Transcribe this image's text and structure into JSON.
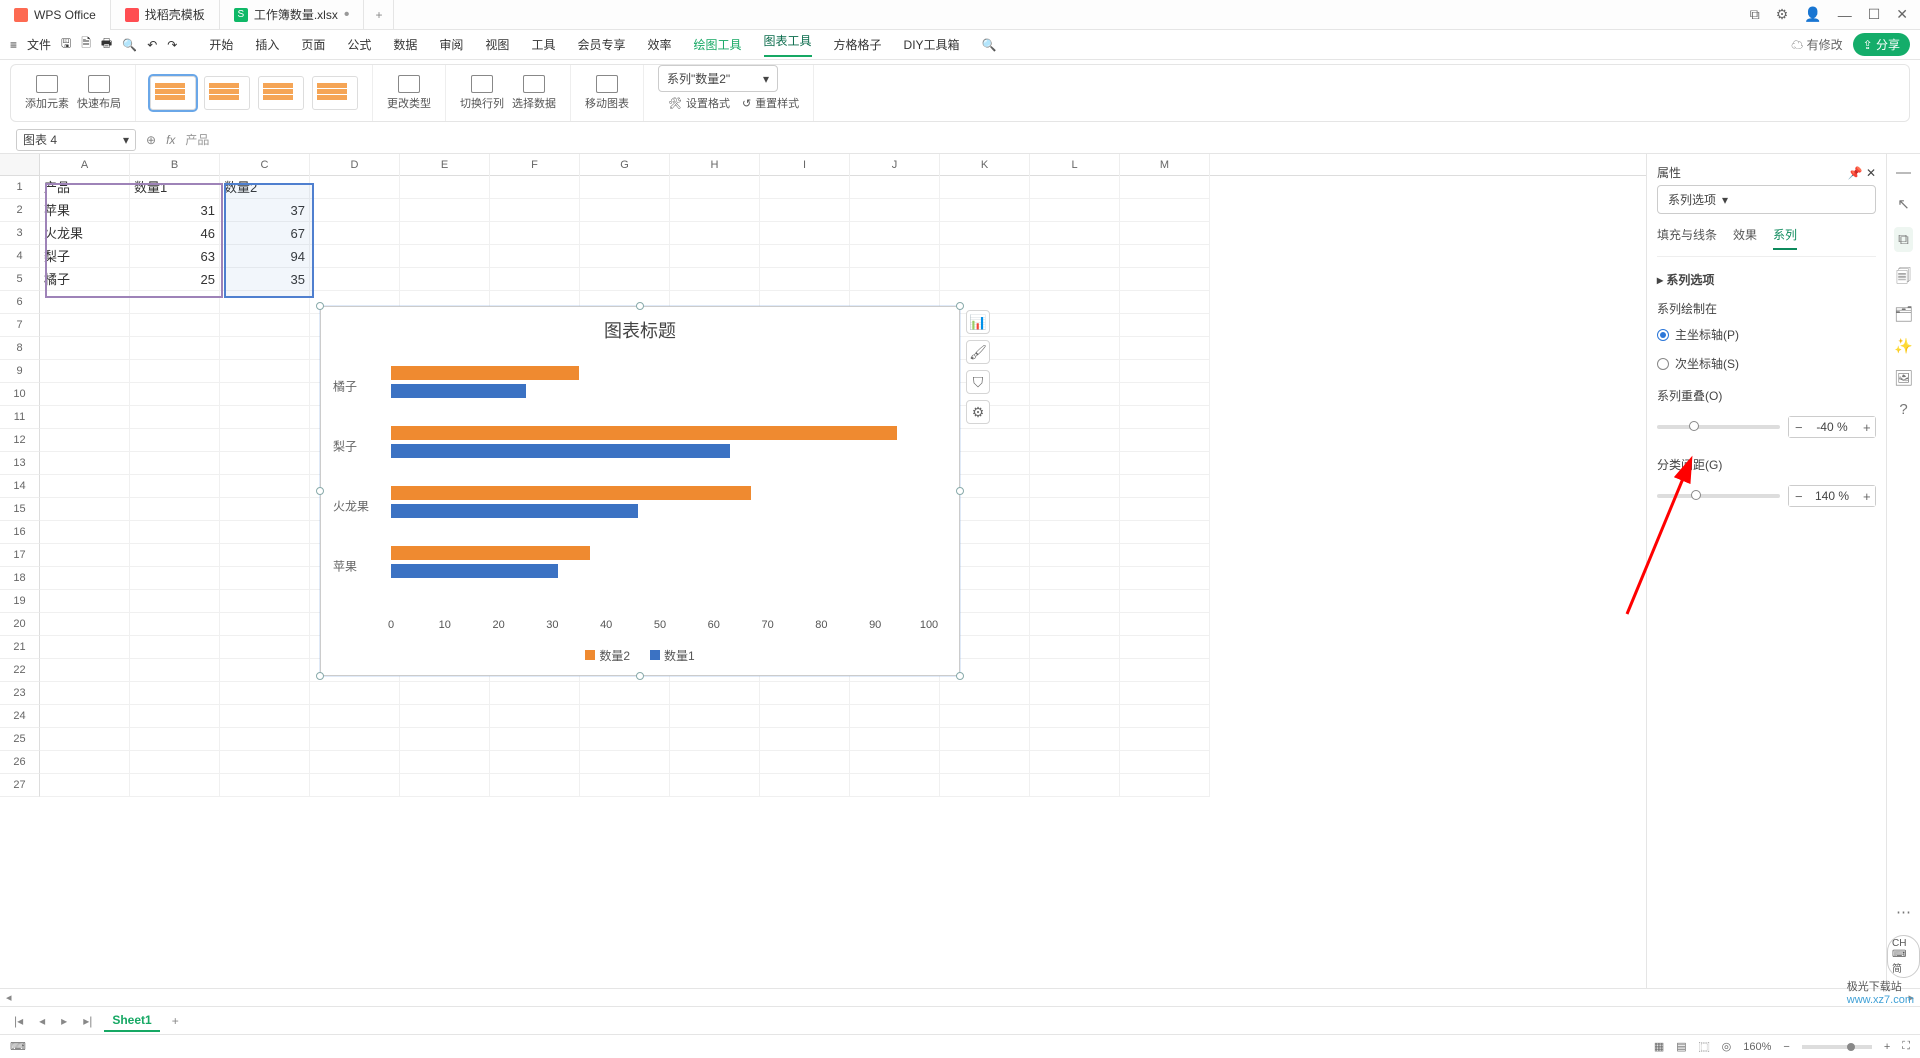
{
  "titlebar": {
    "tabs": [
      {
        "label": "WPS Office"
      },
      {
        "label": "找稻壳模板"
      },
      {
        "label": "工作簿数量.xlsx"
      }
    ],
    "plus": "+"
  },
  "menubar": {
    "file": "文件",
    "tabs": [
      "开始",
      "插入",
      "页面",
      "公式",
      "数据",
      "审阅",
      "视图",
      "工具",
      "会员专享",
      "效率",
      "绘图工具",
      "图表工具",
      "方格格子",
      "DIY工具箱"
    ],
    "cloud": "有修改",
    "share": "分享"
  },
  "ribbon": {
    "add_elem": "添加元素",
    "layout": "快速布局",
    "change_type": "更改类型",
    "swap": "切换行列",
    "sel_data": "选择数据",
    "move": "移动图表",
    "series_select": "系列\"数量2\"",
    "fmt": "设置格式",
    "reset": "重置样式"
  },
  "fbar": {
    "name": "图表 4",
    "fx": "fx",
    "value": "产品"
  },
  "columns": [
    "A",
    "B",
    "C",
    "D",
    "E",
    "F",
    "G",
    "H",
    "I",
    "J",
    "K",
    "L",
    "M"
  ],
  "rows_count": 27,
  "cells": {
    "A1": "产品",
    "B1": "数量1",
    "C1": "数量2",
    "A2": "苹果",
    "B2": "31",
    "C2": "37",
    "A3": "火龙果",
    "B3": "46",
    "C3": "67",
    "A4": "梨子",
    "B4": "63",
    "C4": "94",
    "A5": "橘子",
    "B5": "25",
    "C5": "35"
  },
  "chart_data": {
    "type": "bar",
    "title": "图表标题",
    "categories": [
      "橘子",
      "梨子",
      "火龙果",
      "苹果"
    ],
    "series": [
      {
        "name": "数量2",
        "color": "#ef8a30",
        "values": [
          35,
          94,
          67,
          37
        ]
      },
      {
        "name": "数量1",
        "color": "#3b72c3",
        "values": [
          25,
          63,
          46,
          31
        ]
      }
    ],
    "x_ticks": [
      0,
      10,
      20,
      30,
      40,
      50,
      60,
      70,
      80,
      90,
      100
    ],
    "xlim": [
      0,
      100
    ]
  },
  "side_panel": {
    "title": "属性",
    "dropdown": "系列选项",
    "subtabs": [
      "填充与线条",
      "效果",
      "系列"
    ],
    "section": "系列选项",
    "plot_on": "系列绘制在",
    "axis_primary": "主坐标轴(P)",
    "axis_secondary": "次坐标轴(S)",
    "overlap": "系列重叠(O)",
    "overlap_val": "-40",
    "unit": "%",
    "gap": "分类间距(G)",
    "gap_val": "140"
  },
  "tabs": {
    "sheet": "Sheet1"
  },
  "status": {
    "zoom": "160%",
    "ime": "CH ⌨ 简"
  },
  "watermark": {
    "top": "极光下载站",
    "url": "www.xz7.com"
  }
}
